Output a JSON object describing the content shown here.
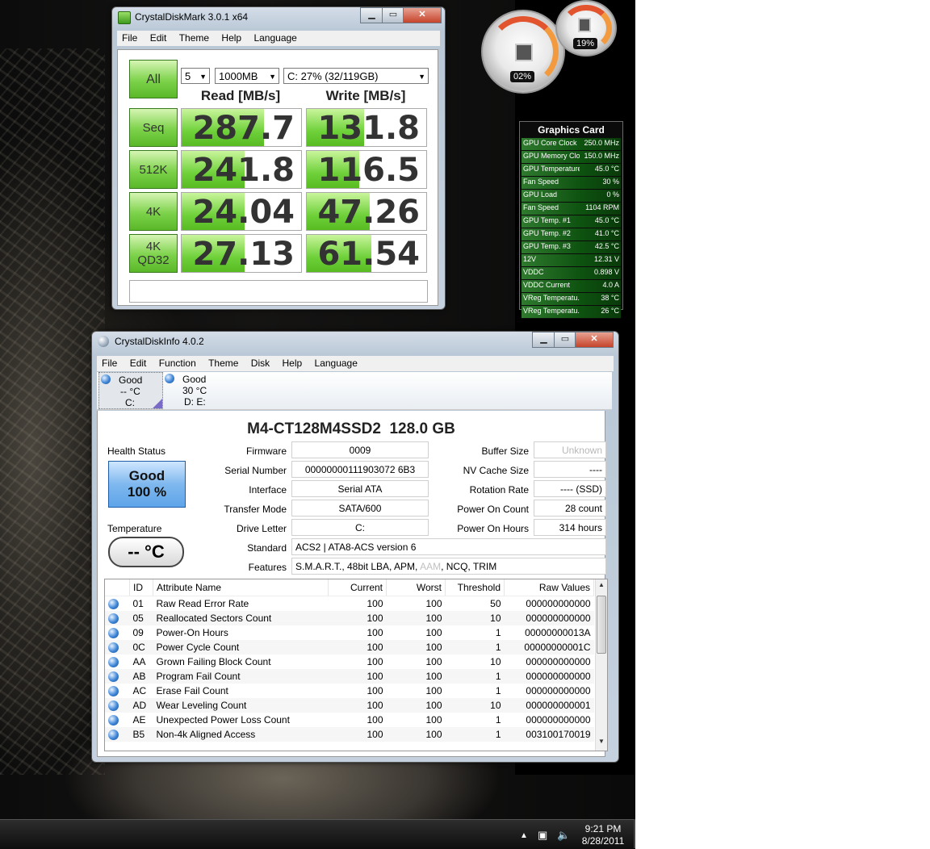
{
  "cdm": {
    "title": "CrystalDiskMark 3.0.1 x64",
    "menu": [
      "File",
      "Edit",
      "Theme",
      "Help",
      "Language"
    ],
    "all_button": "All",
    "count": "5",
    "size": "1000MB",
    "drive": "C: 27% (32/119GB)",
    "read_header": "Read [MB/s]",
    "write_header": "Write [MB/s]",
    "rows": [
      {
        "label": "Seq",
        "read": "287.7",
        "write": "131.8",
        "read_fill": 0.69,
        "write_fill": 0.48
      },
      {
        "label": "512K",
        "read": "241.8",
        "write": "116.5",
        "read_fill": 0.53,
        "write_fill": 0.44
      },
      {
        "label": "4K",
        "read": "24.04",
        "write": "47.26",
        "read_fill": 0.53,
        "write_fill": 0.53
      },
      {
        "label": "4K\nQD32",
        "read": "27.13",
        "write": "61.54",
        "read_fill": 0.53,
        "write_fill": 0.54
      }
    ],
    "comment": ""
  },
  "gauges": {
    "cpu_pct": "02%",
    "mem_pct": "19%"
  },
  "gpu": {
    "title": "Graphics Card",
    "rows": [
      {
        "label": "GPU Core Clock",
        "value": "250.0 MHz"
      },
      {
        "label": "GPU Memory Clo...",
        "value": "150.0 MHz"
      },
      {
        "label": "GPU Temperature",
        "value": "45.0 °C"
      },
      {
        "label": "Fan Speed",
        "value": "30 %"
      },
      {
        "label": "GPU Load",
        "value": "0 %"
      },
      {
        "label": "Fan Speed",
        "value": "1104 RPM"
      },
      {
        "label": "GPU Temp. #1",
        "value": "45.0 °C"
      },
      {
        "label": "GPU Temp. #2",
        "value": "41.0 °C"
      },
      {
        "label": "GPU Temp. #3",
        "value": "42.5 °C"
      },
      {
        "label": "12V",
        "value": "12.31 V"
      },
      {
        "label": "VDDC",
        "value": "0.898 V"
      },
      {
        "label": "VDDC Current",
        "value": "4.0 A"
      },
      {
        "label": "VReg Temperatu...",
        "value": "38 °C"
      },
      {
        "label": "VReg Temperatu...",
        "value": "26 °C"
      }
    ]
  },
  "cdi": {
    "title": "CrystalDiskInfo 4.0.2",
    "menu": [
      "File",
      "Edit",
      "Function",
      "Theme",
      "Disk",
      "Help",
      "Language"
    ],
    "disks": [
      {
        "status": "Good",
        "temp": "-- °C",
        "letter": "C:"
      },
      {
        "status": "Good",
        "temp": "30 °C",
        "letter": "D: E:"
      }
    ],
    "model": "M4-CT128M4SSD2  128.0 GB",
    "health_label": "Health Status",
    "health_status": "Good",
    "health_pct": "100 %",
    "temp_label": "Temperature",
    "temp_value": "-- °C",
    "fields_left": [
      {
        "label": "Firmware",
        "value": "0009"
      },
      {
        "label": "Serial Number",
        "value": "00000000111903072 6B3"
      },
      {
        "label": "Interface",
        "value": "Serial ATA"
      },
      {
        "label": "Transfer Mode",
        "value": "SATA/600"
      },
      {
        "label": "Drive Letter",
        "value": "C:"
      }
    ],
    "fields_right": [
      {
        "label": "Buffer Size",
        "value": "Unknown"
      },
      {
        "label": "NV Cache Size",
        "value": "----"
      },
      {
        "label": "Rotation Rate",
        "value": "---- (SSD)"
      },
      {
        "label": "Power On Count",
        "value": "28 count"
      },
      {
        "label": "Power On Hours",
        "value": "314 hours"
      }
    ],
    "standard_label": "Standard",
    "standard_value": "ACS2 | ATA8-ACS version 6",
    "features_label": "Features",
    "features_value": "S.M.A.R.T., 48bit LBA, APM, ",
    "features_disabled": "AAM",
    "features_value_tail": ", NCQ, TRIM",
    "smart_headers": [
      "ID",
      "Attribute Name",
      "Current",
      "Worst",
      "Threshold",
      "Raw Values"
    ],
    "smart_rows": [
      {
        "id": "01",
        "name": "Raw Read Error Rate",
        "cur": "100",
        "worst": "100",
        "thr": "50",
        "raw": "000000000000"
      },
      {
        "id": "05",
        "name": "Reallocated Sectors Count",
        "cur": "100",
        "worst": "100",
        "thr": "10",
        "raw": "000000000000"
      },
      {
        "id": "09",
        "name": "Power-On Hours",
        "cur": "100",
        "worst": "100",
        "thr": "1",
        "raw": "00000000013A"
      },
      {
        "id": "0C",
        "name": "Power Cycle Count",
        "cur": "100",
        "worst": "100",
        "thr": "1",
        "raw": "00000000001C"
      },
      {
        "id": "AA",
        "name": "Grown Failing Block Count",
        "cur": "100",
        "worst": "100",
        "thr": "10",
        "raw": "000000000000"
      },
      {
        "id": "AB",
        "name": "Program Fail Count",
        "cur": "100",
        "worst": "100",
        "thr": "1",
        "raw": "000000000000"
      },
      {
        "id": "AC",
        "name": "Erase Fail Count",
        "cur": "100",
        "worst": "100",
        "thr": "1",
        "raw": "000000000000"
      },
      {
        "id": "AD",
        "name": "Wear Leveling Count",
        "cur": "100",
        "worst": "100",
        "thr": "10",
        "raw": "000000000001"
      },
      {
        "id": "AE",
        "name": "Unexpected Power Loss Count",
        "cur": "100",
        "worst": "100",
        "thr": "1",
        "raw": "000000000000"
      },
      {
        "id": "B5",
        "name": "Non-4k Aligned Access",
        "cur": "100",
        "worst": "100",
        "thr": "1",
        "raw": "003100170019"
      }
    ]
  },
  "taskbar": {
    "time": "9:21 PM",
    "date": "8/28/2011"
  }
}
